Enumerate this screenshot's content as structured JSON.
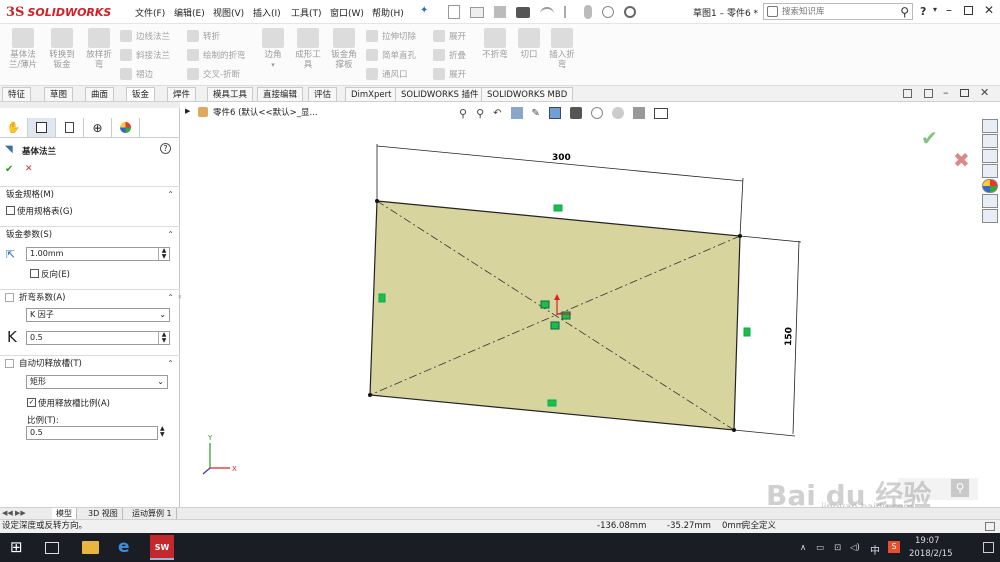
{
  "app": {
    "logo_ds": "3S",
    "logo_text": "SOLIDWORKS",
    "doc_title": "草图1 – 零件6 *"
  },
  "menu": [
    "文件(F)",
    "编辑(E)",
    "视图(V)",
    "插入(I)",
    "工具(T)",
    "窗口(W)",
    "帮助(H)"
  ],
  "search": {
    "placeholder": "搜索知识库"
  },
  "ribbon": {
    "big": [
      {
        "label": "基体法\n兰/薄片"
      },
      {
        "label": "转换到\n钣金"
      },
      {
        "label": "放样折\n弯"
      }
    ],
    "col1": [
      "边线法兰",
      "斜接法兰",
      "褶边"
    ],
    "col2": [
      "转折",
      "绘制的折弯",
      "交叉-折断"
    ],
    "big2": [
      {
        "label": "边角"
      },
      {
        "label": "成形工\n具"
      },
      {
        "label": "钣金角\n撑板"
      }
    ],
    "col3": [
      "拉伸切除",
      "简单直孔",
      "通风口"
    ],
    "col4": [
      "展开",
      "折叠",
      "展开"
    ],
    "big3": [
      {
        "label": "不折弯"
      },
      {
        "label": "切口"
      },
      {
        "label": "插入折\n弯"
      }
    ]
  },
  "tabs": [
    "特征",
    "草图",
    "曲面",
    "钣金",
    "焊件",
    "模具工具",
    "直接编辑",
    "评估",
    "DimXpert",
    "SOLIDWORKS 插件",
    "SOLIDWORKS MBD"
  ],
  "active_tab": "钣金",
  "panel": {
    "feature_title": "基体法兰",
    "help": "?",
    "ok": "✔",
    "cancel": "✕",
    "sec_gauge": "钣金规格(M)",
    "use_gauge": "使用规格表(G)",
    "sec_params": "钣金参数(S)",
    "thickness": "1.00mm",
    "reverse": "反向(E)",
    "sec_bend": "折弯系数(A)",
    "bend_type": "K 因子",
    "k_symbol": "K",
    "k_value": "0.5",
    "sec_relief": "自动切释放槽(T)",
    "relief_type": "矩形",
    "use_ratio": "使用释放槽比例(A)",
    "ratio_label": "比例(T):",
    "ratio_value": "0.5"
  },
  "tree": {
    "item": "零件6 (默认<<默认>_显..."
  },
  "drawing": {
    "dim_width": "300",
    "dim_height": "150",
    "fill": "#d8d49e",
    "stroke": "#222"
  },
  "bottom_tabs": [
    "模型",
    "3D 视图",
    "运动算例 1"
  ],
  "status": {
    "hint": "设定深度或反转方向。",
    "x": "-136.08mm",
    "y": "-35.27mm",
    "z": "0mm",
    "state": "完全定义"
  },
  "watermark": "Bai du 经验",
  "watermark_url": "jingyan.baidu.com",
  "taskbar": {
    "time": "19:07",
    "date": "2018/2/15",
    "ime": "中"
  }
}
